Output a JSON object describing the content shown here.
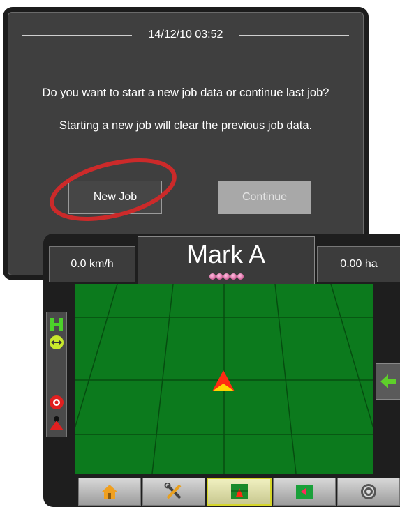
{
  "dialog": {
    "timestamp": "14/12/10 03:52",
    "message_question": "Do you want to start a new job data or continue last job?",
    "message_warning": "Starting a new job will clear the previous job data.",
    "new_job_label": "New Job",
    "continue_label": "Continue"
  },
  "annotation": {
    "highlight_color": "#cc2a2a",
    "highlights": "New Job button"
  },
  "guidance": {
    "speed": "0.0 km/h",
    "mark_label": "Mark A",
    "area": "0.00 ha",
    "field_color": "#0c7a1d",
    "side_icons": [
      "boom-status-icon",
      "swath-width-icon",
      "boomtoggle-icon",
      "spray-icon"
    ],
    "side_arrow": "left-arrow-icon",
    "tabs": [
      {
        "icon": "home-icon",
        "active": false
      },
      {
        "icon": "tools-icon",
        "active": false
      },
      {
        "icon": "guidance-view-icon",
        "active": true
      },
      {
        "icon": "map-icon",
        "active": false
      },
      {
        "icon": "gauge-icon",
        "active": false
      }
    ]
  }
}
